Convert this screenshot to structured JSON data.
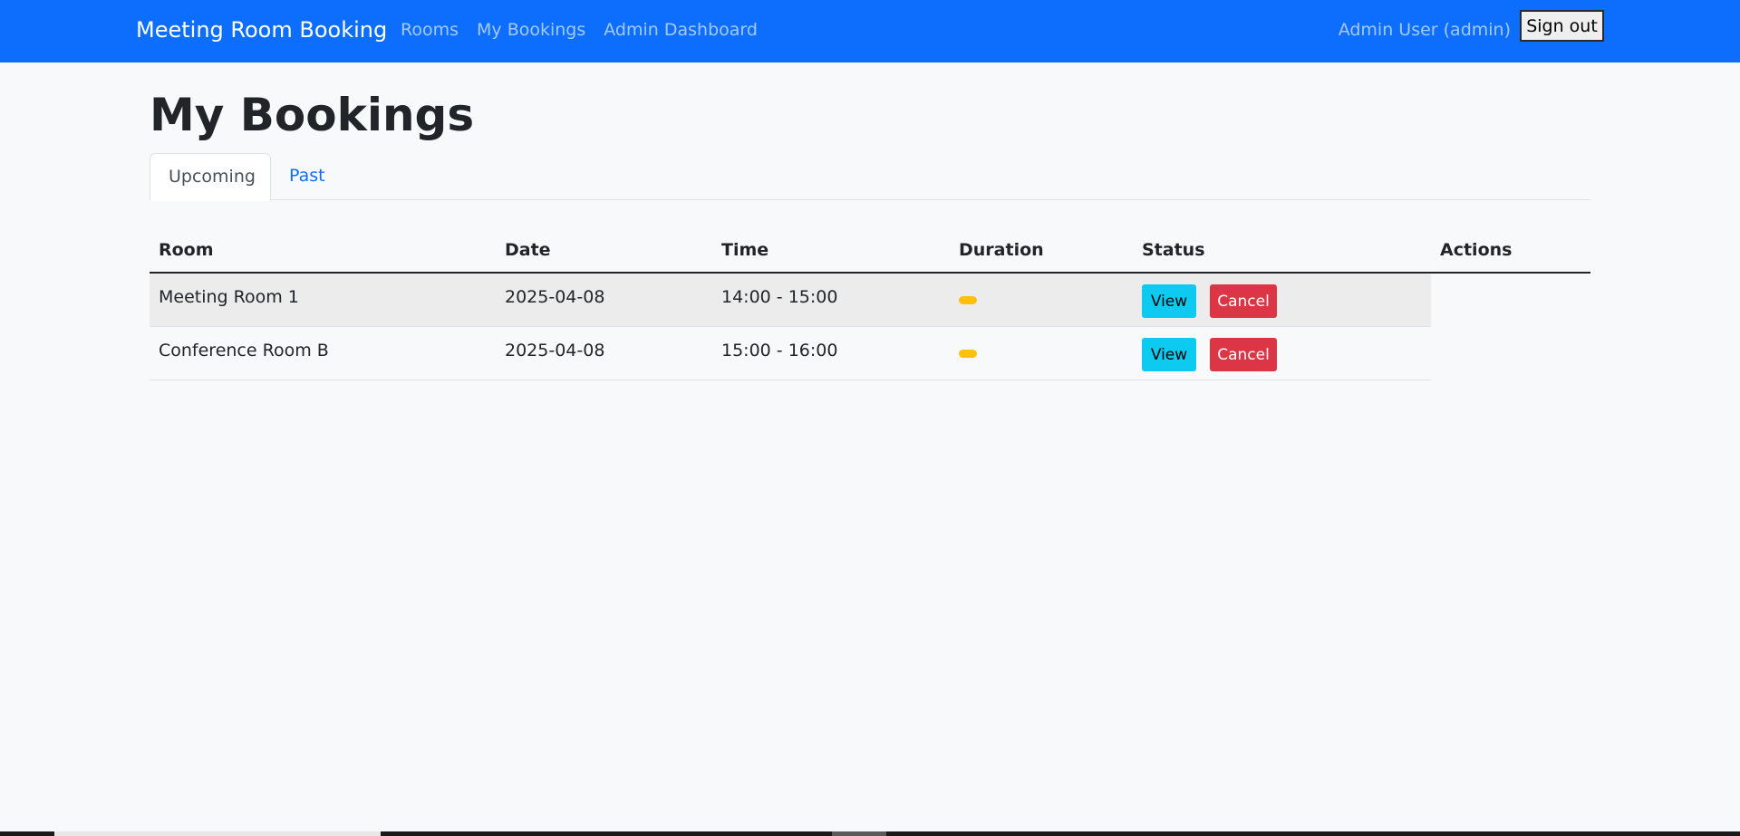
{
  "navbar": {
    "brand": "Meeting Room Booking",
    "links": [
      "Rooms",
      "My Bookings",
      "Admin Dashboard"
    ],
    "user": "Admin User (admin)",
    "signout_label": "Sign out",
    "color": "#0d6efd"
  },
  "page": {
    "title": "My Bookings"
  },
  "tabs": [
    {
      "label": "Upcoming",
      "active": true
    },
    {
      "label": "Past",
      "active": false
    }
  ],
  "table": {
    "headers": [
      "Room",
      "Date",
      "Time",
      "Duration",
      "Status",
      "Actions"
    ],
    "rows": [
      {
        "room": "Meeting Room 1",
        "date": "2025-04-08",
        "time": "14:00 - 15:00",
        "status_color": "#ffc107",
        "view_label": "View",
        "cancel_label": "Cancel"
      },
      {
        "room": "Conference Room B",
        "date": "2025-04-08",
        "time": "15:00 - 16:00",
        "status_color": "#ffc107",
        "view_label": "View",
        "cancel_label": "Cancel"
      }
    ]
  }
}
